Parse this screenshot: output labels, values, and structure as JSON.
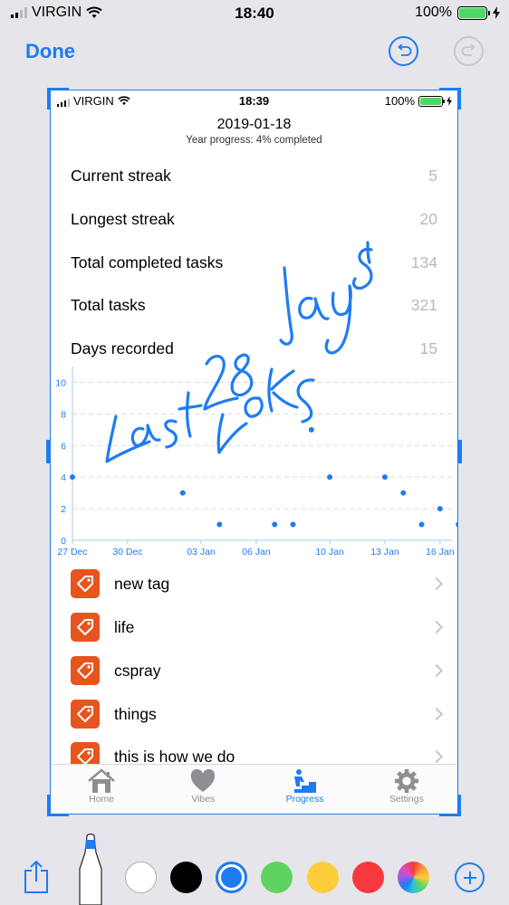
{
  "status": {
    "carrier": "VIRGIN",
    "time": "18:40",
    "battery": "100%"
  },
  "editor": {
    "done_label": "Done",
    "undo_icon": "undo-icon",
    "redo_icon": "redo-icon"
  },
  "screenshot": {
    "status": {
      "carrier": "VIRGIN",
      "time": "18:39",
      "battery": "100%"
    },
    "date": "2019-01-18",
    "year_progress": "Year progress: 4% completed",
    "stats": [
      {
        "label": "Current streak",
        "value": "5"
      },
      {
        "label": "Longest streak",
        "value": "20"
      },
      {
        "label": "Total completed tasks",
        "value": "134"
      },
      {
        "label": "Total tasks",
        "value": "321"
      },
      {
        "label": "Days recorded",
        "value": "15"
      }
    ],
    "tags": [
      {
        "name": "new tag"
      },
      {
        "name": "life"
      },
      {
        "name": "cspray"
      },
      {
        "name": "things"
      },
      {
        "name": "this is how we do"
      }
    ],
    "tabs": [
      {
        "label": "Home",
        "icon": "home-icon",
        "active": false
      },
      {
        "label": "Vibes",
        "icon": "heart-icon",
        "active": false
      },
      {
        "label": "Progress",
        "icon": "progress-stairs-icon",
        "active": true
      },
      {
        "label": "Settings",
        "icon": "gear-icon",
        "active": false
      }
    ]
  },
  "chart_data": {
    "type": "scatter",
    "color": "#1e7cf2",
    "x_tick_labels": [
      "27 Dec",
      "30 Dec",
      "03 Jan",
      "06 Jan",
      "10 Jan",
      "13 Jan",
      "16 Jan"
    ],
    "x_tick_days": [
      0,
      3,
      7,
      10,
      14,
      17,
      20
    ],
    "x_range_days": [
      0,
      20.5
    ],
    "y_ticks": [
      0,
      2,
      4,
      6,
      8,
      10
    ],
    "ylim": [
      0,
      11
    ],
    "points": [
      {
        "x": "27 Dec",
        "y": 4
      },
      {
        "x": "02 Jan",
        "y": 3
      },
      {
        "x": "04 Jan",
        "y": 1
      },
      {
        "x": "07 Jan",
        "y": 1
      },
      {
        "x": "08 Jan",
        "y": 1
      },
      {
        "x": "09 Jan",
        "y": 7
      },
      {
        "x": "10 Jan",
        "y": 4
      },
      {
        "x": "13 Jan",
        "y": 4
      },
      {
        "x": "14 Jan",
        "y": 3
      },
      {
        "x": "15 Jan",
        "y": 1
      },
      {
        "x": "16 Jan",
        "y": 2
      },
      {
        "x": "17 Jan",
        "y": 1
      }
    ],
    "grid": "dashed horizontal"
  },
  "handwriting": {
    "lines": [
      "Last 28 days",
      "days"
    ],
    "color": "#1e7cf2"
  },
  "markup_tools": {
    "share_icon": "share-icon",
    "pen_icon": "marker-pen-icon",
    "colors": [
      "#ffffff",
      "#000000",
      "#1e7cf2",
      "#5fd35f",
      "#fdcd3c",
      "#f7383f",
      "multicolor"
    ],
    "selected_color": "#1e7cf2",
    "add_icon": "add-icon"
  }
}
